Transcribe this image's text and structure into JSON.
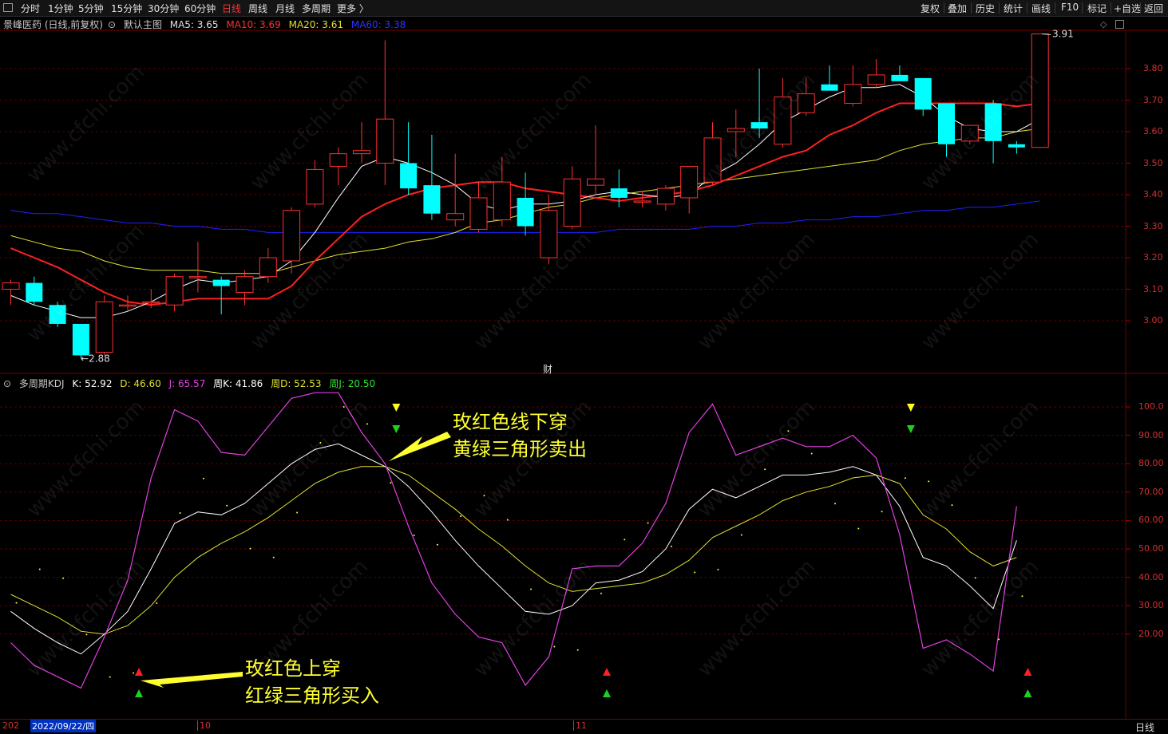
{
  "toolbar": {
    "left": [
      "分时",
      "1分钟",
      "5分钟",
      "15分钟",
      "30分钟",
      "60分钟",
      "日线",
      "周线",
      "月线",
      "多周期",
      "更多 〉"
    ],
    "active_index": 6,
    "right": [
      "复权",
      "叠加",
      "历史",
      "统计",
      "画线",
      "F10",
      "标记",
      "+自选",
      "返回"
    ]
  },
  "main_info": {
    "stock": "景峰医药 (日线,前复权)",
    "template": "默认主图",
    "ma5": "MA5: 3.65",
    "ma10": "MA10: 3.69",
    "ma20": "MA20: 3.61",
    "ma60": "MA60: 3.38"
  },
  "kdj_info": {
    "name": "多周期KDJ",
    "k": "K: 52.92",
    "d": "D: 46.60",
    "j": "J: 65.57",
    "wk": "周K: 41.86",
    "wd": "周D: 52.53",
    "wj": "周J: 20.50"
  },
  "colors": {
    "up": "#ff3030",
    "down": "#00ffff",
    "ma5": "#ffffff",
    "ma10": "#ff2020",
    "ma20": "#e0e030",
    "ma60": "#2020ff",
    "j_line": "#e040e0",
    "k_line": "#ffffff",
    "d_line": "#e0e030"
  },
  "price_axis": [
    "3.80",
    "3.70",
    "3.60",
    "3.50",
    "3.40",
    "3.30",
    "3.20",
    "3.10",
    "3.00"
  ],
  "kdj_axis": [
    "100.0",
    "90.00",
    "80.00",
    "70.00",
    "60.00",
    "50.00",
    "40.00",
    "30.00",
    "20.00"
  ],
  "labels": {
    "high": "3.91",
    "low": "2.88",
    "fin": "财"
  },
  "bottom": {
    "left_year": "202",
    "date": "2022/09/22/四",
    "month1": "10",
    "month2": "11",
    "period": "日线"
  },
  "annotations": {
    "sell_line1": "玫红色线下穿",
    "sell_line2": "黄绿三角形卖出",
    "buy_line1": "玫红色上穿",
    "buy_line2": "红绿三角形买入"
  },
  "watermark": "www.cfchi.com",
  "chart_data": {
    "type": "candlestick",
    "candles": [
      {
        "o": 3.1,
        "c": 3.12,
        "h": 3.13,
        "l": 3.05
      },
      {
        "o": 3.12,
        "c": 3.06,
        "h": 3.14,
        "l": 3.05
      },
      {
        "o": 3.05,
        "c": 2.99,
        "h": 3.06,
        "l": 2.98
      },
      {
        "o": 2.99,
        "c": 2.89,
        "h": 2.99,
        "l": 2.88
      },
      {
        "o": 2.9,
        "c": 3.06,
        "h": 3.08,
        "l": 2.89
      },
      {
        "o": 3.05,
        "c": 3.05,
        "h": 3.08,
        "l": 3.03
      },
      {
        "o": 3.06,
        "c": 3.06,
        "h": 3.1,
        "l": 3.04
      },
      {
        "o": 3.05,
        "c": 3.14,
        "h": 3.15,
        "l": 3.03
      },
      {
        "o": 3.14,
        "c": 3.14,
        "h": 3.25,
        "l": 3.09
      },
      {
        "o": 3.13,
        "c": 3.11,
        "h": 3.14,
        "l": 3.02
      },
      {
        "o": 3.09,
        "c": 3.14,
        "h": 3.16,
        "l": 3.05
      },
      {
        "o": 3.14,
        "c": 3.2,
        "h": 3.23,
        "l": 3.12
      },
      {
        "o": 3.19,
        "c": 3.35,
        "h": 3.36,
        "l": 3.15
      },
      {
        "o": 3.37,
        "c": 3.48,
        "h": 3.51,
        "l": 3.36
      },
      {
        "o": 3.49,
        "c": 3.53,
        "h": 3.55,
        "l": 3.43
      },
      {
        "o": 3.53,
        "c": 3.54,
        "h": 3.63,
        "l": 3.5
      },
      {
        "o": 3.5,
        "c": 3.64,
        "h": 3.89,
        "l": 3.43
      },
      {
        "o": 3.5,
        "c": 3.42,
        "h": 3.63,
        "l": 3.4
      },
      {
        "o": 3.43,
        "c": 3.34,
        "h": 3.59,
        "l": 3.32
      },
      {
        "o": 3.32,
        "c": 3.34,
        "h": 3.53,
        "l": 3.3
      },
      {
        "o": 3.29,
        "c": 3.39,
        "h": 3.44,
        "l": 3.28
      },
      {
        "o": 3.32,
        "c": 3.44,
        "h": 3.52,
        "l": 3.3
      },
      {
        "o": 3.39,
        "c": 3.3,
        "h": 3.47,
        "l": 3.27
      },
      {
        "o": 3.2,
        "c": 3.35,
        "h": 3.4,
        "l": 3.18
      },
      {
        "o": 3.3,
        "c": 3.45,
        "h": 3.49,
        "l": 3.29
      },
      {
        "o": 3.43,
        "c": 3.45,
        "h": 3.62,
        "l": 3.4
      },
      {
        "o": 3.42,
        "c": 3.39,
        "h": 3.48,
        "l": 3.36
      },
      {
        "o": 3.38,
        "c": 3.38,
        "h": 3.41,
        "l": 3.36
      },
      {
        "o": 3.37,
        "c": 3.42,
        "h": 3.43,
        "l": 3.35
      },
      {
        "o": 3.39,
        "c": 3.49,
        "h": 3.49,
        "l": 3.34
      },
      {
        "o": 3.44,
        "c": 3.58,
        "h": 3.63,
        "l": 3.43
      },
      {
        "o": 3.6,
        "c": 3.61,
        "h": 3.67,
        "l": 3.52
      },
      {
        "o": 3.63,
        "c": 3.61,
        "h": 3.8,
        "l": 3.58
      },
      {
        "o": 3.56,
        "c": 3.71,
        "h": 3.77,
        "l": 3.55
      },
      {
        "o": 3.66,
        "c": 3.72,
        "h": 3.77,
        "l": 3.65
      },
      {
        "o": 3.75,
        "c": 3.73,
        "h": 3.81,
        "l": 3.73
      },
      {
        "o": 3.69,
        "c": 3.75,
        "h": 3.81,
        "l": 3.68
      },
      {
        "o": 3.75,
        "c": 3.78,
        "h": 3.83,
        "l": 3.74
      },
      {
        "o": 3.78,
        "c": 3.76,
        "h": 3.81,
        "l": 3.76
      },
      {
        "o": 3.77,
        "c": 3.67,
        "h": 3.77,
        "l": 3.65
      },
      {
        "o": 3.69,
        "c": 3.56,
        "h": 3.69,
        "l": 3.52
      },
      {
        "o": 3.57,
        "c": 3.62,
        "h": 3.62,
        "l": 3.56
      },
      {
        "o": 3.69,
        "c": 3.57,
        "h": 3.7,
        "l": 3.5
      },
      {
        "o": 3.56,
        "c": 3.55,
        "h": 3.57,
        "l": 3.53
      },
      {
        "o": 3.55,
        "c": 3.91,
        "h": 3.91,
        "l": 3.55
      }
    ],
    "ma5": [
      3.08,
      3.05,
      3.03,
      3.01,
      3.01,
      3.03,
      3.06,
      3.1,
      3.13,
      3.12,
      3.13,
      3.14,
      3.19,
      3.28,
      3.39,
      3.49,
      3.52,
      3.5,
      3.47,
      3.43,
      3.37,
      3.35,
      3.37,
      3.37,
      3.38,
      3.4,
      3.41,
      3.4,
      3.39,
      3.4,
      3.46,
      3.5,
      3.56,
      3.63,
      3.67,
      3.71,
      3.74,
      3.74,
      3.75,
      3.71,
      3.65,
      3.61,
      3.6,
      3.6,
      3.64
    ],
    "ma10": [
      3.23,
      3.2,
      3.17,
      3.13,
      3.09,
      3.06,
      3.05,
      3.06,
      3.07,
      3.07,
      3.07,
      3.07,
      3.11,
      3.19,
      3.26,
      3.33,
      3.37,
      3.4,
      3.42,
      3.43,
      3.44,
      3.44,
      3.42,
      3.41,
      3.4,
      3.39,
      3.38,
      3.39,
      3.4,
      3.41,
      3.43,
      3.46,
      3.49,
      3.52,
      3.54,
      3.59,
      3.62,
      3.66,
      3.69,
      3.69,
      3.69,
      3.69,
      3.69,
      3.68,
      3.69
    ],
    "ma20": [
      3.27,
      3.25,
      3.23,
      3.22,
      3.19,
      3.17,
      3.16,
      3.16,
      3.16,
      3.15,
      3.15,
      3.15,
      3.17,
      3.19,
      3.21,
      3.22,
      3.23,
      3.25,
      3.26,
      3.28,
      3.31,
      3.32,
      3.34,
      3.36,
      3.37,
      3.39,
      3.4,
      3.41,
      3.42,
      3.43,
      3.44,
      3.45,
      3.46,
      3.47,
      3.48,
      3.49,
      3.5,
      3.51,
      3.54,
      3.56,
      3.57,
      3.58,
      3.58,
      3.6,
      3.61
    ],
    "ma60": [
      3.35,
      3.34,
      3.34,
      3.33,
      3.32,
      3.31,
      3.31,
      3.3,
      3.3,
      3.29,
      3.29,
      3.28,
      3.28,
      3.28,
      3.28,
      3.28,
      3.28,
      3.28,
      3.28,
      3.28,
      3.28,
      3.28,
      3.28,
      3.28,
      3.28,
      3.28,
      3.29,
      3.29,
      3.29,
      3.29,
      3.3,
      3.3,
      3.31,
      3.31,
      3.32,
      3.32,
      3.33,
      3.33,
      3.34,
      3.35,
      3.35,
      3.36,
      3.36,
      3.37,
      3.38
    ],
    "kdj_j": [
      17,
      9,
      5,
      1,
      19,
      39,
      75,
      99,
      95,
      84,
      83,
      93,
      103,
      105,
      105,
      91,
      80,
      58,
      38,
      27,
      19,
      17,
      2,
      12,
      43,
      44,
      44,
      52,
      66,
      91,
      101,
      83,
      86,
      89,
      86,
      86,
      90,
      82,
      55,
      15,
      18,
      13,
      7,
      65
    ],
    "kdj_k": [
      28,
      22,
      17,
      13,
      20,
      28,
      43,
      59,
      63,
      62,
      66,
      73,
      80,
      85,
      87,
      83,
      79,
      72,
      63,
      53,
      44,
      36,
      28,
      27,
      30,
      38,
      39,
      42,
      50,
      64,
      71,
      68,
      72,
      76,
      76,
      77,
      79,
      76,
      65,
      47,
      44,
      37,
      29,
      53
    ],
    "kdj_d": [
      34,
      30,
      26,
      21,
      20,
      23,
      30,
      40,
      47,
      52,
      56,
      61,
      67,
      73,
      77,
      79,
      79,
      76,
      70,
      64,
      57,
      51,
      44,
      38,
      35,
      36,
      37,
      38,
      41,
      46,
      54,
      58,
      62,
      67,
      70,
      72,
      75,
      76,
      73,
      62,
      57,
      49,
      44,
      47
    ],
    "buy_signals": [
      5,
      25,
      43
    ],
    "sell_signals": [
      16,
      38
    ]
  }
}
